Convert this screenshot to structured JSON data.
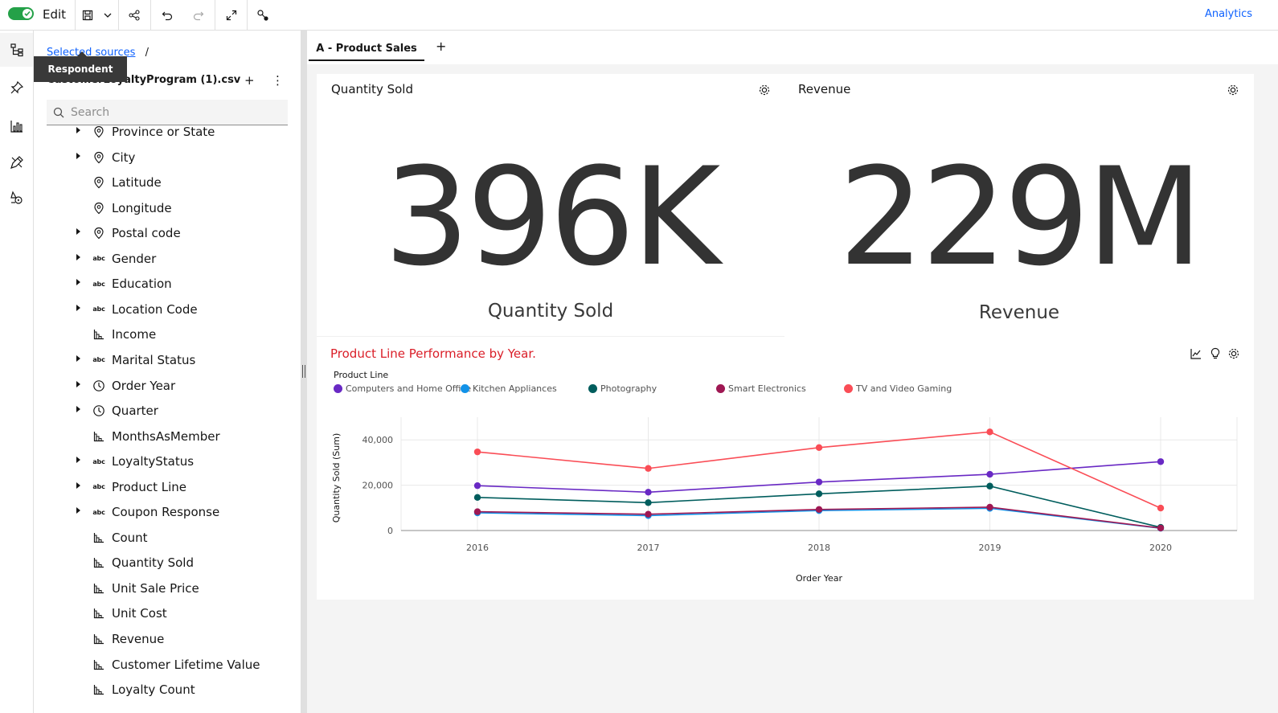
{
  "toolbar": {
    "edit_label": "Edit",
    "analytics_label": "Analytics"
  },
  "rail": {
    "items": [
      "data-sources",
      "pin",
      "visualizations",
      "widgets",
      "navigation"
    ]
  },
  "datapanel": {
    "breadcrumb_link": "Selected sources",
    "breadcrumb_sep": "/",
    "source_name": "CustomerLoyaltyProgram (1).csv",
    "tooltip": "Respondent",
    "search_placeholder": "Search",
    "fields": [
      {
        "label": "Province or State",
        "icon": "geo",
        "expandable": true
      },
      {
        "label": "City",
        "icon": "geo",
        "expandable": true
      },
      {
        "label": "Latitude",
        "icon": "geo",
        "expandable": false
      },
      {
        "label": "Longitude",
        "icon": "geo",
        "expandable": false
      },
      {
        "label": "Postal code",
        "icon": "geo",
        "expandable": true
      },
      {
        "label": "Gender",
        "icon": "abc",
        "expandable": true
      },
      {
        "label": "Education",
        "icon": "abc",
        "expandable": true
      },
      {
        "label": "Location Code",
        "icon": "abc",
        "expandable": true
      },
      {
        "label": "Income",
        "icon": "measure",
        "expandable": false
      },
      {
        "label": "Marital Status",
        "icon": "abc",
        "expandable": true
      },
      {
        "label": "Order Year",
        "icon": "time",
        "expandable": true
      },
      {
        "label": "Quarter",
        "icon": "time",
        "expandable": true
      },
      {
        "label": "MonthsAsMember",
        "icon": "measure",
        "expandable": false
      },
      {
        "label": "LoyaltyStatus",
        "icon": "abc",
        "expandable": true
      },
      {
        "label": "Product Line",
        "icon": "abc",
        "expandable": true
      },
      {
        "label": "Coupon Response",
        "icon": "abc",
        "expandable": true
      },
      {
        "label": "Count",
        "icon": "measure",
        "expandable": false
      },
      {
        "label": "Quantity Sold",
        "icon": "measure",
        "expandable": false
      },
      {
        "label": "Unit Sale Price",
        "icon": "measure",
        "expandable": false
      },
      {
        "label": "Unit Cost",
        "icon": "measure",
        "expandable": false
      },
      {
        "label": "Revenue",
        "icon": "measure",
        "expandable": false
      },
      {
        "label": "Customer Lifetime Value",
        "icon": "measure",
        "expandable": false
      },
      {
        "label": "Loyalty Count",
        "icon": "measure",
        "expandable": false
      }
    ]
  },
  "canvas": {
    "tab_label": "A - Product Sales",
    "tab_add": "+",
    "kpi_quantity": {
      "title": "Quantity Sold",
      "value": "396K",
      "caption": "Quantity Sold"
    },
    "kpi_revenue": {
      "title": "Revenue",
      "value": "229M",
      "caption": "Revenue"
    }
  },
  "colors": {
    "accent": "#0f62fe",
    "toggle_on": "#24a148",
    "chart_title": "#da1e28"
  },
  "chart_data": {
    "type": "line",
    "title": "Product Line Performance by Year.",
    "legend_title": "Product Line",
    "legend_position": "top-left",
    "xlabel": "Order Year",
    "ylabel": "Quantity Sold (Sum)",
    "categories": [
      "2016",
      "2017",
      "2018",
      "2019",
      "2020"
    ],
    "ylim": [
      0,
      50000
    ],
    "yticks": [
      0,
      20000,
      40000
    ],
    "ytick_labels": [
      "0",
      "20,000",
      "40,000"
    ],
    "grid": true,
    "series": [
      {
        "name": "Computers and Home Office",
        "color": "#6929c4",
        "values": [
          19800,
          16900,
          21400,
          24800,
          30400
        ]
      },
      {
        "name": "Kitchen Appliances",
        "color": "#1192e8",
        "values": [
          7800,
          6600,
          8800,
          9800,
          1000
        ]
      },
      {
        "name": "Photography",
        "color": "#005d5d",
        "values": [
          14600,
          12300,
          16200,
          19600,
          1400
        ]
      },
      {
        "name": "Smart Electronics",
        "color": "#9f1853",
        "values": [
          8300,
          7200,
          9300,
          10300,
          1100
        ]
      },
      {
        "name": "TV and Video Gaming",
        "color": "#fa4d56",
        "values": [
          34700,
          27400,
          36600,
          43500,
          9900
        ]
      }
    ]
  }
}
